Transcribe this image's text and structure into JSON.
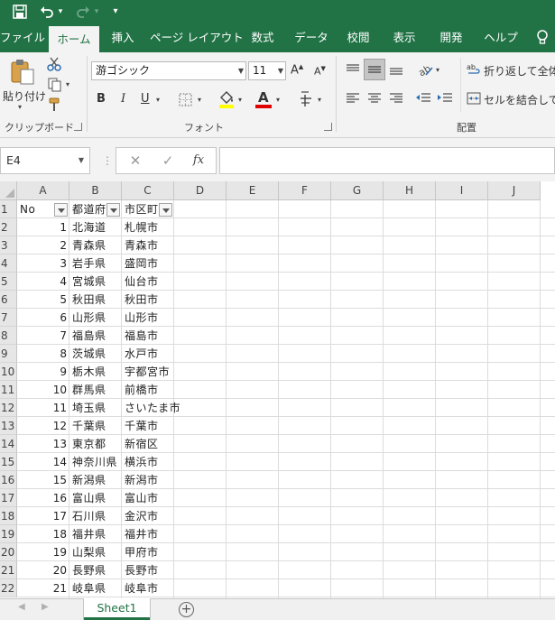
{
  "quick_access": {
    "more": "▾"
  },
  "tabs": [
    "ファイル",
    "ホーム",
    "挿入",
    "ページ レイアウト",
    "数式",
    "データ",
    "校閲",
    "表示",
    "開発",
    "ヘルプ"
  ],
  "ribbon": {
    "clipboard": {
      "paste_label": "貼り付け",
      "group_label": "クリップボード"
    },
    "font": {
      "font_name": "游ゴシック",
      "font_size": "11",
      "bold": "B",
      "italic": "I",
      "underline": "U",
      "font_color_glyph": "A",
      "grow": "A",
      "shrink": "A",
      "group_label": "フォント",
      "highlight_color": "#ffff00",
      "font_color": "#e00000"
    },
    "alignment": {
      "wrap_text": "折り返して全体を",
      "merge_center": "セルを結合して中",
      "group_label": "配置"
    }
  },
  "formula_bar": {
    "name_box": "E4",
    "cancel": "✕",
    "enter": "✓",
    "fx": "fx",
    "formula": ""
  },
  "grid": {
    "columns": [
      "A",
      "B",
      "C",
      "D",
      "E",
      "F",
      "G",
      "H",
      "I",
      "J"
    ],
    "row_numbers": [
      "1",
      "2",
      "3",
      "4",
      "5",
      "6",
      "7",
      "8",
      "9",
      "10",
      "11",
      "12",
      "13",
      "14",
      "15",
      "16",
      "17",
      "18",
      "19",
      "20",
      "21",
      "22"
    ],
    "headers": [
      "No",
      "都道府",
      "市区町"
    ],
    "rows": [
      [
        "1",
        "北海道",
        "札幌市"
      ],
      [
        "2",
        "青森県",
        "青森市"
      ],
      [
        "3",
        "岩手県",
        "盛岡市"
      ],
      [
        "4",
        "宮城県",
        "仙台市"
      ],
      [
        "5",
        "秋田県",
        "秋田市"
      ],
      [
        "6",
        "山形県",
        "山形市"
      ],
      [
        "7",
        "福島県",
        "福島市"
      ],
      [
        "8",
        "茨城県",
        "水戸市"
      ],
      [
        "9",
        "栃木県",
        "宇都宮市"
      ],
      [
        "10",
        "群馬県",
        "前橋市"
      ],
      [
        "11",
        "埼玉県",
        "さいたま市"
      ],
      [
        "12",
        "千葉県",
        "千葉市"
      ],
      [
        "13",
        "東京都",
        "新宿区"
      ],
      [
        "14",
        "神奈川県",
        "横浜市"
      ],
      [
        "15",
        "新潟県",
        "新潟市"
      ],
      [
        "16",
        "富山県",
        "富山市"
      ],
      [
        "17",
        "石川県",
        "金沢市"
      ],
      [
        "18",
        "福井県",
        "福井市"
      ],
      [
        "19",
        "山梨県",
        "甲府市"
      ],
      [
        "20",
        "長野県",
        "長野市"
      ],
      [
        "21",
        "岐阜県",
        "岐阜市"
      ]
    ]
  },
  "sheet_tabs": {
    "active": "Sheet1",
    "add": "+",
    "prev": "◀",
    "next": "▶"
  },
  "colors": {
    "accent": "#217346",
    "ribbon_bg": "#f3f3f3",
    "header_bg": "#e6e6e6"
  }
}
